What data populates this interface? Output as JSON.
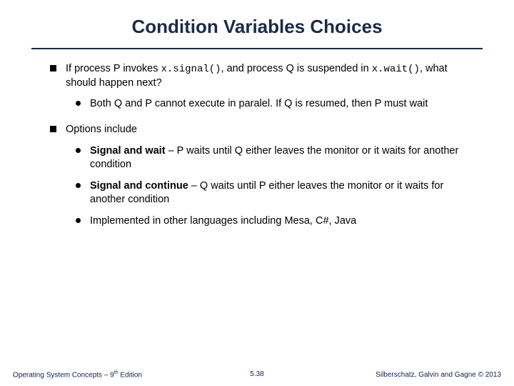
{
  "title": "Condition Variables Choices",
  "b1": {
    "t1": "If process P invokes ",
    "c1": "x.signal()",
    "t2": ", and process Q is suspended in ",
    "c2": "x.wait()",
    "t3": ", what should happen next?",
    "sub1": "Both Q and P cannot execute in paralel. If Q is resumed, then P must wait"
  },
  "b2": {
    "t1": "Options include",
    "s1": {
      "b": "Signal and wait",
      "t": " – P waits until Q either leaves the monitor or it waits for another condition"
    },
    "s2": {
      "b": "Signal and continue",
      "t": " – Q waits until P either leaves the monitor or it waits for another condition"
    },
    "s3": "Implemented in other languages including Mesa, C#, Java"
  },
  "footer": {
    "left1": "Operating System Concepts – 9",
    "left2": "th",
    "left3": " Edition",
    "center": "5.38",
    "right": "Silberschatz, Galvin and Gagne © 2013"
  }
}
